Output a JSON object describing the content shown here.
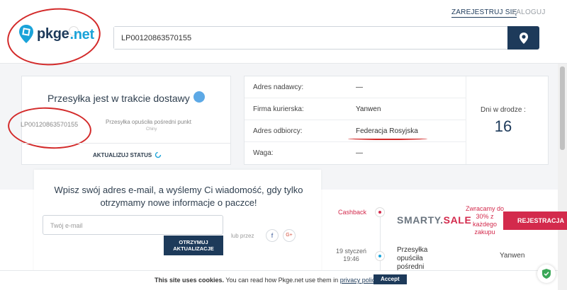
{
  "header": {
    "logo_text": "pkge",
    "logo_suffix": ".net",
    "register_label": "ZAREJESTRUJ SIĘ",
    "login_label": "ZALOGUJ",
    "search_value": "LP00120863570155"
  },
  "status": {
    "title": "Przesyłka jest w trakcie dostawy",
    "tracking_number": "LP00120863570155",
    "last_event": "Przesyłka opuściła pośredni punkt",
    "last_event_location": "Chiny",
    "refresh_label": "AKTUALIZUJ STATUS"
  },
  "details": {
    "rows": [
      {
        "label": "Adres nadawcy:",
        "value": "—"
      },
      {
        "label": "Firma kurierska:",
        "value": "Yanwen"
      },
      {
        "label": "Adres odbiorcy:",
        "value": "Federacja Rosyjska"
      },
      {
        "label": "Waga:",
        "value": "—"
      }
    ],
    "days_label": "Dni w drodze :",
    "days_value": "16"
  },
  "subscribe": {
    "title": "Wpisz swój adres e-mail, a wyślemy Ci wiadomość, gdy tylko otrzymamy nowe informacje o paczce!",
    "email_placeholder": "Twój e-mail",
    "button_label": "OTRZYMUJ AKTUALIZACJE",
    "or_label": "lub przez",
    "facebook": "f",
    "google": "G+"
  },
  "timeline": {
    "cashback_label": "Cashback",
    "smarty_main": "SMARTY.",
    "smarty_sale": "SALE",
    "promo_text": "Zwracamy do 30% z każdego zakupu",
    "register_button": "REJESTRACJA",
    "event_date": "19 styczeń",
    "event_time": "19:46",
    "event_text": "Przesyłka opuściła pośredni",
    "event_carrier": "Yanwen"
  },
  "cookie": {
    "bold": "This site uses cookies.",
    "text": "You can read how Pkge.net use them in",
    "link": "privacy policy",
    "accept": "Accept"
  },
  "colors": {
    "brand_dark": "#1d3a5a",
    "accent_blue": "#1aa3d9",
    "accent_red": "#d32a4c",
    "annotation_red": "#d32a2a"
  }
}
